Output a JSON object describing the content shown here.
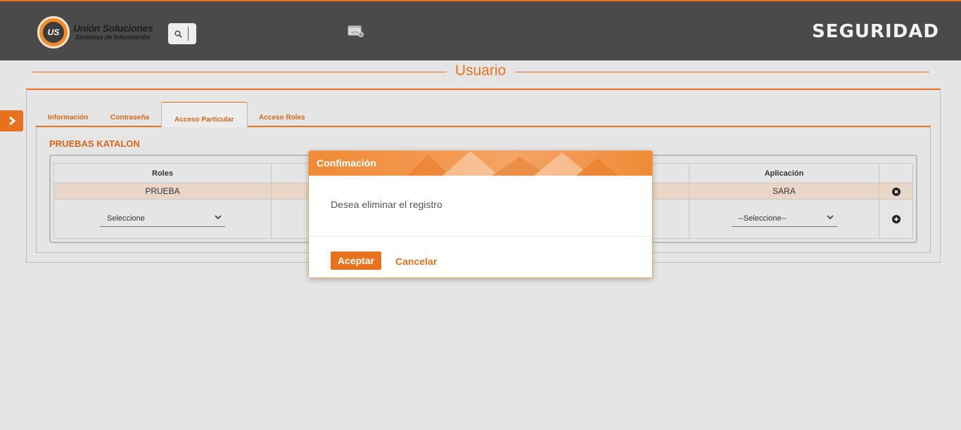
{
  "header": {
    "brand_name": "Unión Soluciones",
    "brand_tagline": "Sistemas de Información",
    "logo_text": "US",
    "app_title": "SEGURIDAD"
  },
  "page": {
    "title": "Usuario"
  },
  "tabs": [
    {
      "label": "Información"
    },
    {
      "label": "Contraseña"
    },
    {
      "label": "Acceso Particular",
      "active": true
    },
    {
      "label": "Acceso Roles"
    }
  ],
  "user": {
    "name": "PRUEBAS KATALON"
  },
  "grid": {
    "columns": {
      "roles": "Roles",
      "aplicacion": "Aplicación"
    },
    "row": {
      "rol": "PRUEBA",
      "aplicacion": "SARA"
    },
    "new_row": {
      "rol_select": "Seleccione",
      "aplicacion_select": "--Seleccione--"
    }
  },
  "modal": {
    "title": "Confimación",
    "message": "Desea eliminar el registro",
    "accept": "Aceptar",
    "cancel": "Cancelar"
  },
  "colors": {
    "accent": "#e8711d",
    "header_bg": "#4a4a4a",
    "page_bg": "#e5e5e5"
  }
}
